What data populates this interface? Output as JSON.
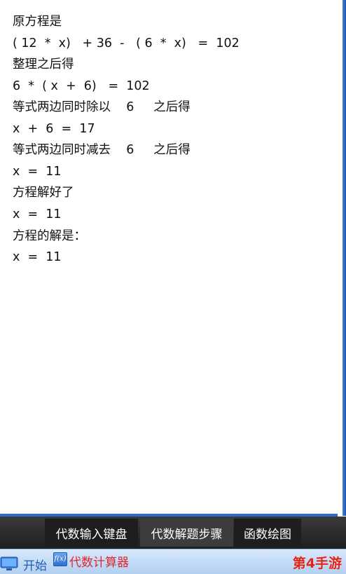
{
  "solution": {
    "lines": [
      "原方程是",
      "( 12  *  x)   + 36  -   ( 6  *  x)   =  102",
      "整理之后得",
      "6  *  ( x  +  6)   =  102",
      "等式两边同时除以    6     之后得",
      "x  +  6  =  17",
      "等式两边同时减去    6     之后得",
      "x  =  11",
      "方程解好了",
      "x  =  11",
      "方程的解是：",
      "x  =  11"
    ]
  },
  "tabs": {
    "keyboard": "代数输入键盘",
    "steps": "代数解题步骤",
    "graph": "函数绘图"
  },
  "taskbar": {
    "start_label": "开始",
    "app_icon_text": "f(x)",
    "app_label": "代数计算器",
    "brand": "第4手游"
  },
  "colors": {
    "accent_blue": "#2d6bd1",
    "tab_active": "#3c3c3c",
    "brand_red": "#e2231a"
  }
}
